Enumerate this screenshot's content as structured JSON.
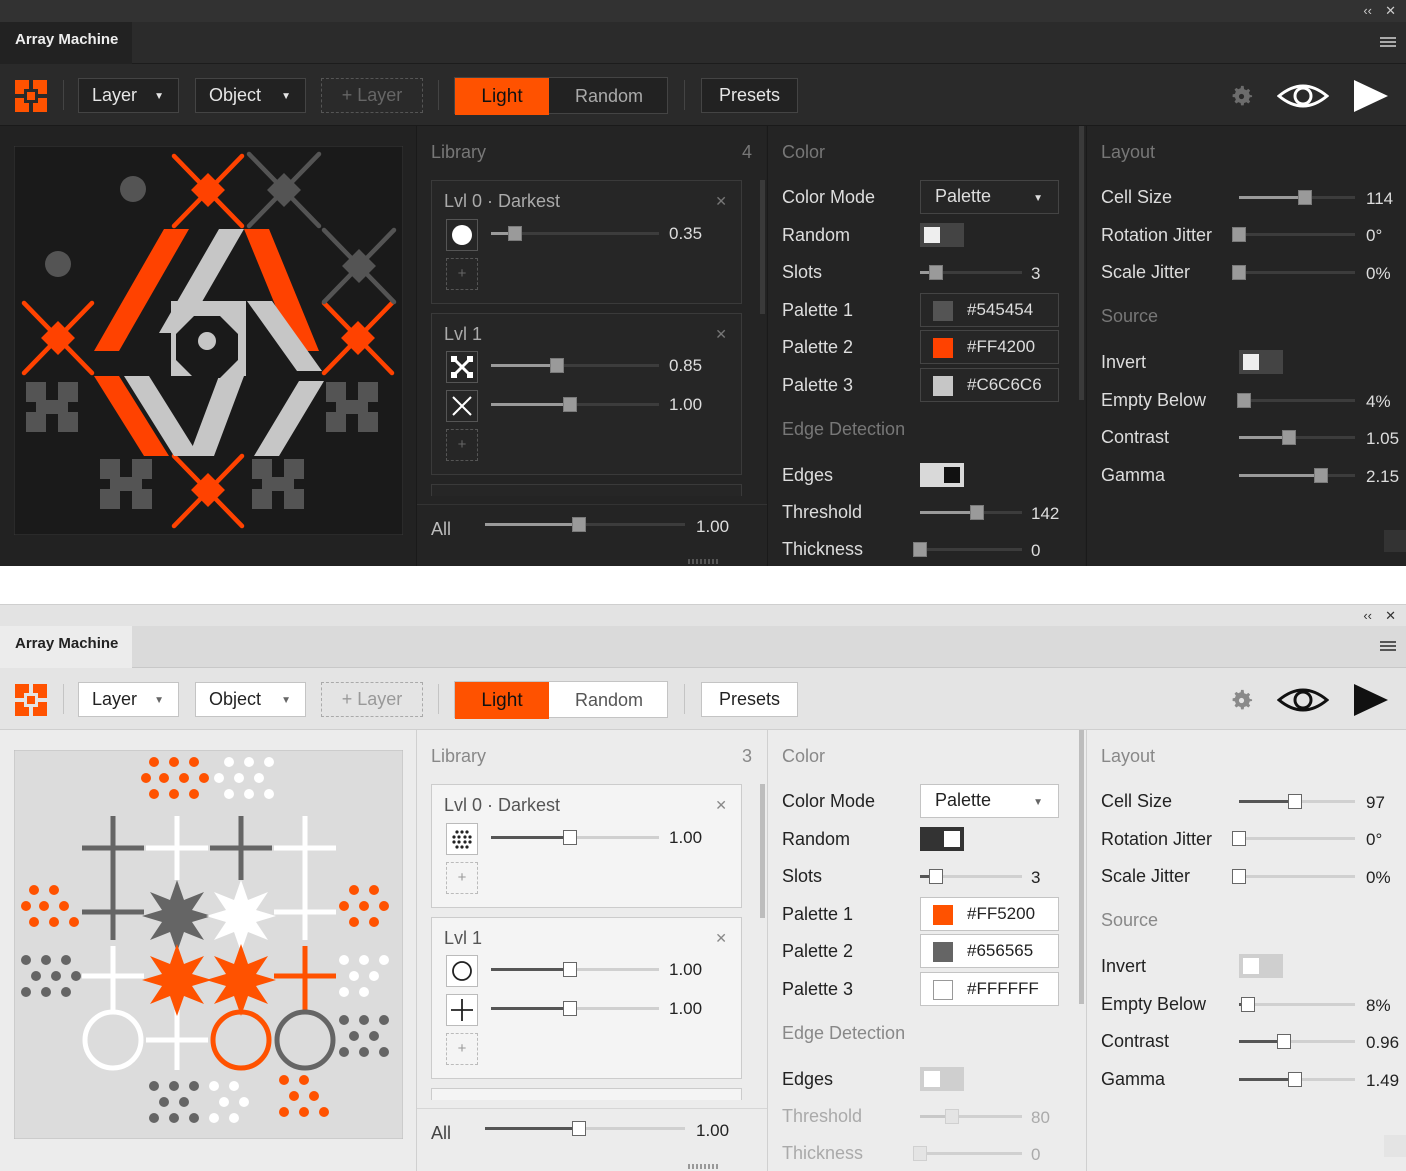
{
  "panels": [
    {
      "theme": "dark",
      "window": {
        "collapse": "‹‹",
        "close": "✕"
      },
      "tab": "Array Machine",
      "toolbar": {
        "layer_dd": "Layer",
        "object_dd": "Object",
        "add_layer": "+ Layer",
        "seg_light": "Light",
        "seg_random": "Random",
        "presets": "Presets"
      },
      "library": {
        "title": "Library",
        "count": "4",
        "lvl0": {
          "title": "Lvl 0 · Darkest",
          "item_value": "0.35"
        },
        "lvl1": {
          "title": "Lvl 1",
          "item1_value": "0.85",
          "item2_value": "1.00"
        },
        "all_label": "All",
        "all_value": "1.00"
      },
      "color": {
        "title": "Color",
        "color_mode_label": "Color Mode",
        "color_mode_value": "Palette",
        "random_label": "Random",
        "slots_label": "Slots",
        "slots_value": "3",
        "palette1_label": "Palette 1",
        "palette1": "#545454",
        "palette2_label": "Palette 2",
        "palette2": "#FF4200",
        "palette3_label": "Palette 3",
        "palette3": "#C6C6C6",
        "edge_title": "Edge Detection",
        "edges_label": "Edges",
        "threshold_label": "Threshold",
        "threshold_value": "142",
        "thickness_label": "Thickness",
        "thickness_value": "0"
      },
      "layout": {
        "title": "Layout",
        "cell_size_label": "Cell Size",
        "cell_size_value": "114",
        "rotation_label": "Rotation Jitter",
        "rotation_value": "0°",
        "scale_label": "Scale Jitter",
        "scale_value": "0%",
        "source_title": "Source",
        "invert_label": "Invert",
        "empty_label": "Empty Below",
        "empty_value": "4%",
        "contrast_label": "Contrast",
        "contrast_value": "1.05",
        "gamma_label": "Gamma",
        "gamma_value": "2.15"
      },
      "sliders": {
        "lvl0": 0.14,
        "lvl1a": 0.39,
        "lvl1b": 0.47,
        "all": 0.47,
        "slots": 0.16,
        "threshold": 0.56,
        "thickness": 0.0,
        "cell": 0.57,
        "rotation": 0.0,
        "scale": 0.0,
        "empty": 0.04,
        "contrast": 0.43,
        "gamma": 0.71
      },
      "toggles": {
        "random": false,
        "edges": true,
        "invert": false
      },
      "colors": {
        "accent": "#ff5200"
      }
    },
    {
      "theme": "light",
      "window": {
        "collapse": "‹‹",
        "close": "✕"
      },
      "tab": "Array Machine",
      "toolbar": {
        "layer_dd": "Layer",
        "object_dd": "Object",
        "add_layer": "+ Layer",
        "seg_light": "Light",
        "seg_random": "Random",
        "presets": "Presets"
      },
      "library": {
        "title": "Library",
        "count": "3",
        "lvl0": {
          "title": "Lvl 0 · Darkest",
          "item_value": "1.00"
        },
        "lvl1": {
          "title": "Lvl 1",
          "item1_value": "1.00",
          "item2_value": "1.00"
        },
        "all_label": "All",
        "all_value": "1.00"
      },
      "color": {
        "title": "Color",
        "color_mode_label": "Color Mode",
        "color_mode_value": "Palette",
        "random_label": "Random",
        "slots_label": "Slots",
        "slots_value": "3",
        "palette1_label": "Palette 1",
        "palette1": "#FF5200",
        "palette2_label": "Palette 2",
        "palette2": "#656565",
        "palette3_label": "Palette 3",
        "palette3": "#FFFFFF",
        "edge_title": "Edge Detection",
        "edges_label": "Edges",
        "threshold_label": "Threshold",
        "threshold_value": "80",
        "thickness_label": "Thickness",
        "thickness_value": "0"
      },
      "layout": {
        "title": "Layout",
        "cell_size_label": "Cell Size",
        "cell_size_value": "97",
        "rotation_label": "Rotation Jitter",
        "rotation_value": "0°",
        "scale_label": "Scale Jitter",
        "scale_value": "0%",
        "source_title": "Source",
        "invert_label": "Invert",
        "empty_label": "Empty Below",
        "empty_value": "8%",
        "contrast_label": "Contrast",
        "contrast_value": "0.96",
        "gamma_label": "Gamma",
        "gamma_value": "1.49"
      },
      "sliders": {
        "lvl0": 0.47,
        "lvl1a": 0.47,
        "lvl1b": 0.47,
        "all": 0.47,
        "slots": 0.16,
        "threshold": 0.31,
        "thickness": 0.0,
        "cell": 0.48,
        "rotation": 0.0,
        "scale": 0.0,
        "empty": 0.08,
        "contrast": 0.39,
        "gamma": 0.48
      },
      "toggles": {
        "random": true,
        "edges": false,
        "invert": false
      },
      "colors": {
        "accent": "#ff5200"
      }
    }
  ]
}
